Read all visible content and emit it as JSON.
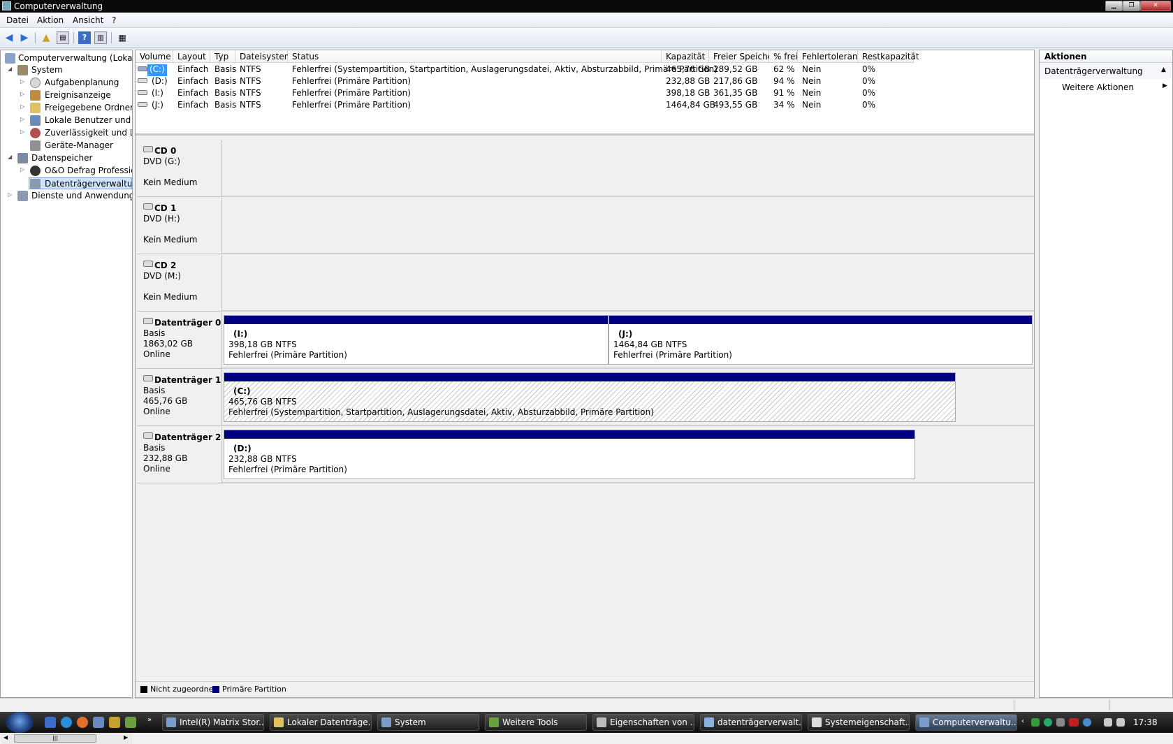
{
  "window": {
    "title": "Computerverwaltung"
  },
  "menu": [
    "Datei",
    "Aktion",
    "Ansicht",
    "?"
  ],
  "tree": [
    {
      "label": "Computerverwaltung (Lokal)",
      "level": 0,
      "expander": ""
    },
    {
      "label": "System",
      "level": 1,
      "expander": "◢"
    },
    {
      "label": "Aufgabenplanung",
      "level": 2,
      "expander": "▷"
    },
    {
      "label": "Ereignisanzeige",
      "level": 2,
      "expander": "▷"
    },
    {
      "label": "Freigegebene Ordner",
      "level": 2,
      "expander": "▷"
    },
    {
      "label": "Lokale Benutzer und Gr",
      "level": 2,
      "expander": "▷"
    },
    {
      "label": "Zuverlässigkeit und Leis",
      "level": 2,
      "expander": "▷"
    },
    {
      "label": "Geräte-Manager",
      "level": 2,
      "expander": ""
    },
    {
      "label": "Datenspeicher",
      "level": 1,
      "expander": "◢"
    },
    {
      "label": "O&O Defrag Profession",
      "level": 2,
      "expander": "▷"
    },
    {
      "label": "Datenträgerverwaltung",
      "level": 2,
      "expander": "",
      "selected": true
    },
    {
      "label": "Dienste und Anwendungen",
      "level": 1,
      "expander": "▷"
    }
  ],
  "volume_table": {
    "columns": [
      "Volume",
      "Layout",
      "Typ",
      "Dateisystem",
      "Status",
      "Kapazität",
      "Freier Speicher",
      "% frei",
      "Fehlertoleranz",
      "Restkapazität"
    ],
    "rows": [
      [
        "(C:)",
        "Einfach",
        "Basis",
        "NTFS",
        "Fehlerfrei (Systempartition, Startpartition, Auslagerungsdatei, Aktiv, Absturzabbild, Primäre Partition)",
        "465,76 GB",
        "289,52 GB",
        "62 %",
        "Nein",
        "0%"
      ],
      [
        "(D:)",
        "Einfach",
        "Basis",
        "NTFS",
        "Fehlerfrei (Primäre Partition)",
        "232,88 GB",
        "217,86 GB",
        "94 %",
        "Nein",
        "0%"
      ],
      [
        "(I:)",
        "Einfach",
        "Basis",
        "NTFS",
        "Fehlerfrei (Primäre Partition)",
        "398,18 GB",
        "361,35 GB",
        "91 %",
        "Nein",
        "0%"
      ],
      [
        "(J:)",
        "Einfach",
        "Basis",
        "NTFS",
        "Fehlerfrei (Primäre Partition)",
        "1464,84 GB",
        "493,55 GB",
        "34 %",
        "Nein",
        "0%"
      ]
    ]
  },
  "cd_drives": [
    {
      "name": "CD 0",
      "drive": "DVD (G:)",
      "media": "Kein Medium"
    },
    {
      "name": "CD 1",
      "drive": "DVD (H:)",
      "media": "Kein Medium"
    },
    {
      "name": "CD 2",
      "drive": "DVD (M:)",
      "media": "Kein Medium"
    }
  ],
  "disks": [
    {
      "name": "Datenträger 0",
      "type": "Basis",
      "size": "1863,02 GB",
      "state": "Online",
      "partitions": [
        {
          "label": "(I:)",
          "size": "398,18 GB NTFS",
          "status": "Fehlerfrei (Primäre Partition)"
        },
        {
          "label": "(J:)",
          "size": "1464,84 GB NTFS",
          "status": "Fehlerfrei (Primäre Partition)"
        }
      ]
    },
    {
      "name": "Datenträger 1",
      "type": "Basis",
      "size": "465,76 GB",
      "state": "Online",
      "partitions": [
        {
          "label": "(C:)",
          "size": "465,76 GB NTFS",
          "status": "Fehlerfrei (Systempartition, Startpartition, Auslagerungsdatei, Aktiv, Absturzabbild, Primäre Partition)"
        }
      ]
    },
    {
      "name": "Datenträger 2",
      "type": "Basis",
      "size": "232,88 GB",
      "state": "Online",
      "partitions": [
        {
          "label": "(D:)",
          "size": "232,88 GB NTFS",
          "status": "Fehlerfrei (Primäre Partition)"
        }
      ]
    }
  ],
  "legend": [
    {
      "label": "Nicht zugeordnet",
      "color": "#000000"
    },
    {
      "label": "Primäre Partition",
      "color": "#000080"
    }
  ],
  "actions": {
    "title": "Aktionen",
    "section": "Datenträgerverwaltung",
    "item": "Weitere Aktionen"
  },
  "taskbar": {
    "items": [
      {
        "label": "Intel(R) Matrix Stor..."
      },
      {
        "label": "Lokaler Datenträge..."
      },
      {
        "label": "System"
      },
      {
        "label": "Weitere Tools"
      },
      {
        "label": "Eigenschaften von ..."
      },
      {
        "label": "datenträgerverwalt..."
      },
      {
        "label": "Systemeigenschaft..."
      },
      {
        "label": "Computerverwaltu...",
        "active": true
      }
    ],
    "clock": "17:38"
  },
  "colors": {
    "primary_partition": "#000080",
    "selection": "#cfe3fa"
  }
}
